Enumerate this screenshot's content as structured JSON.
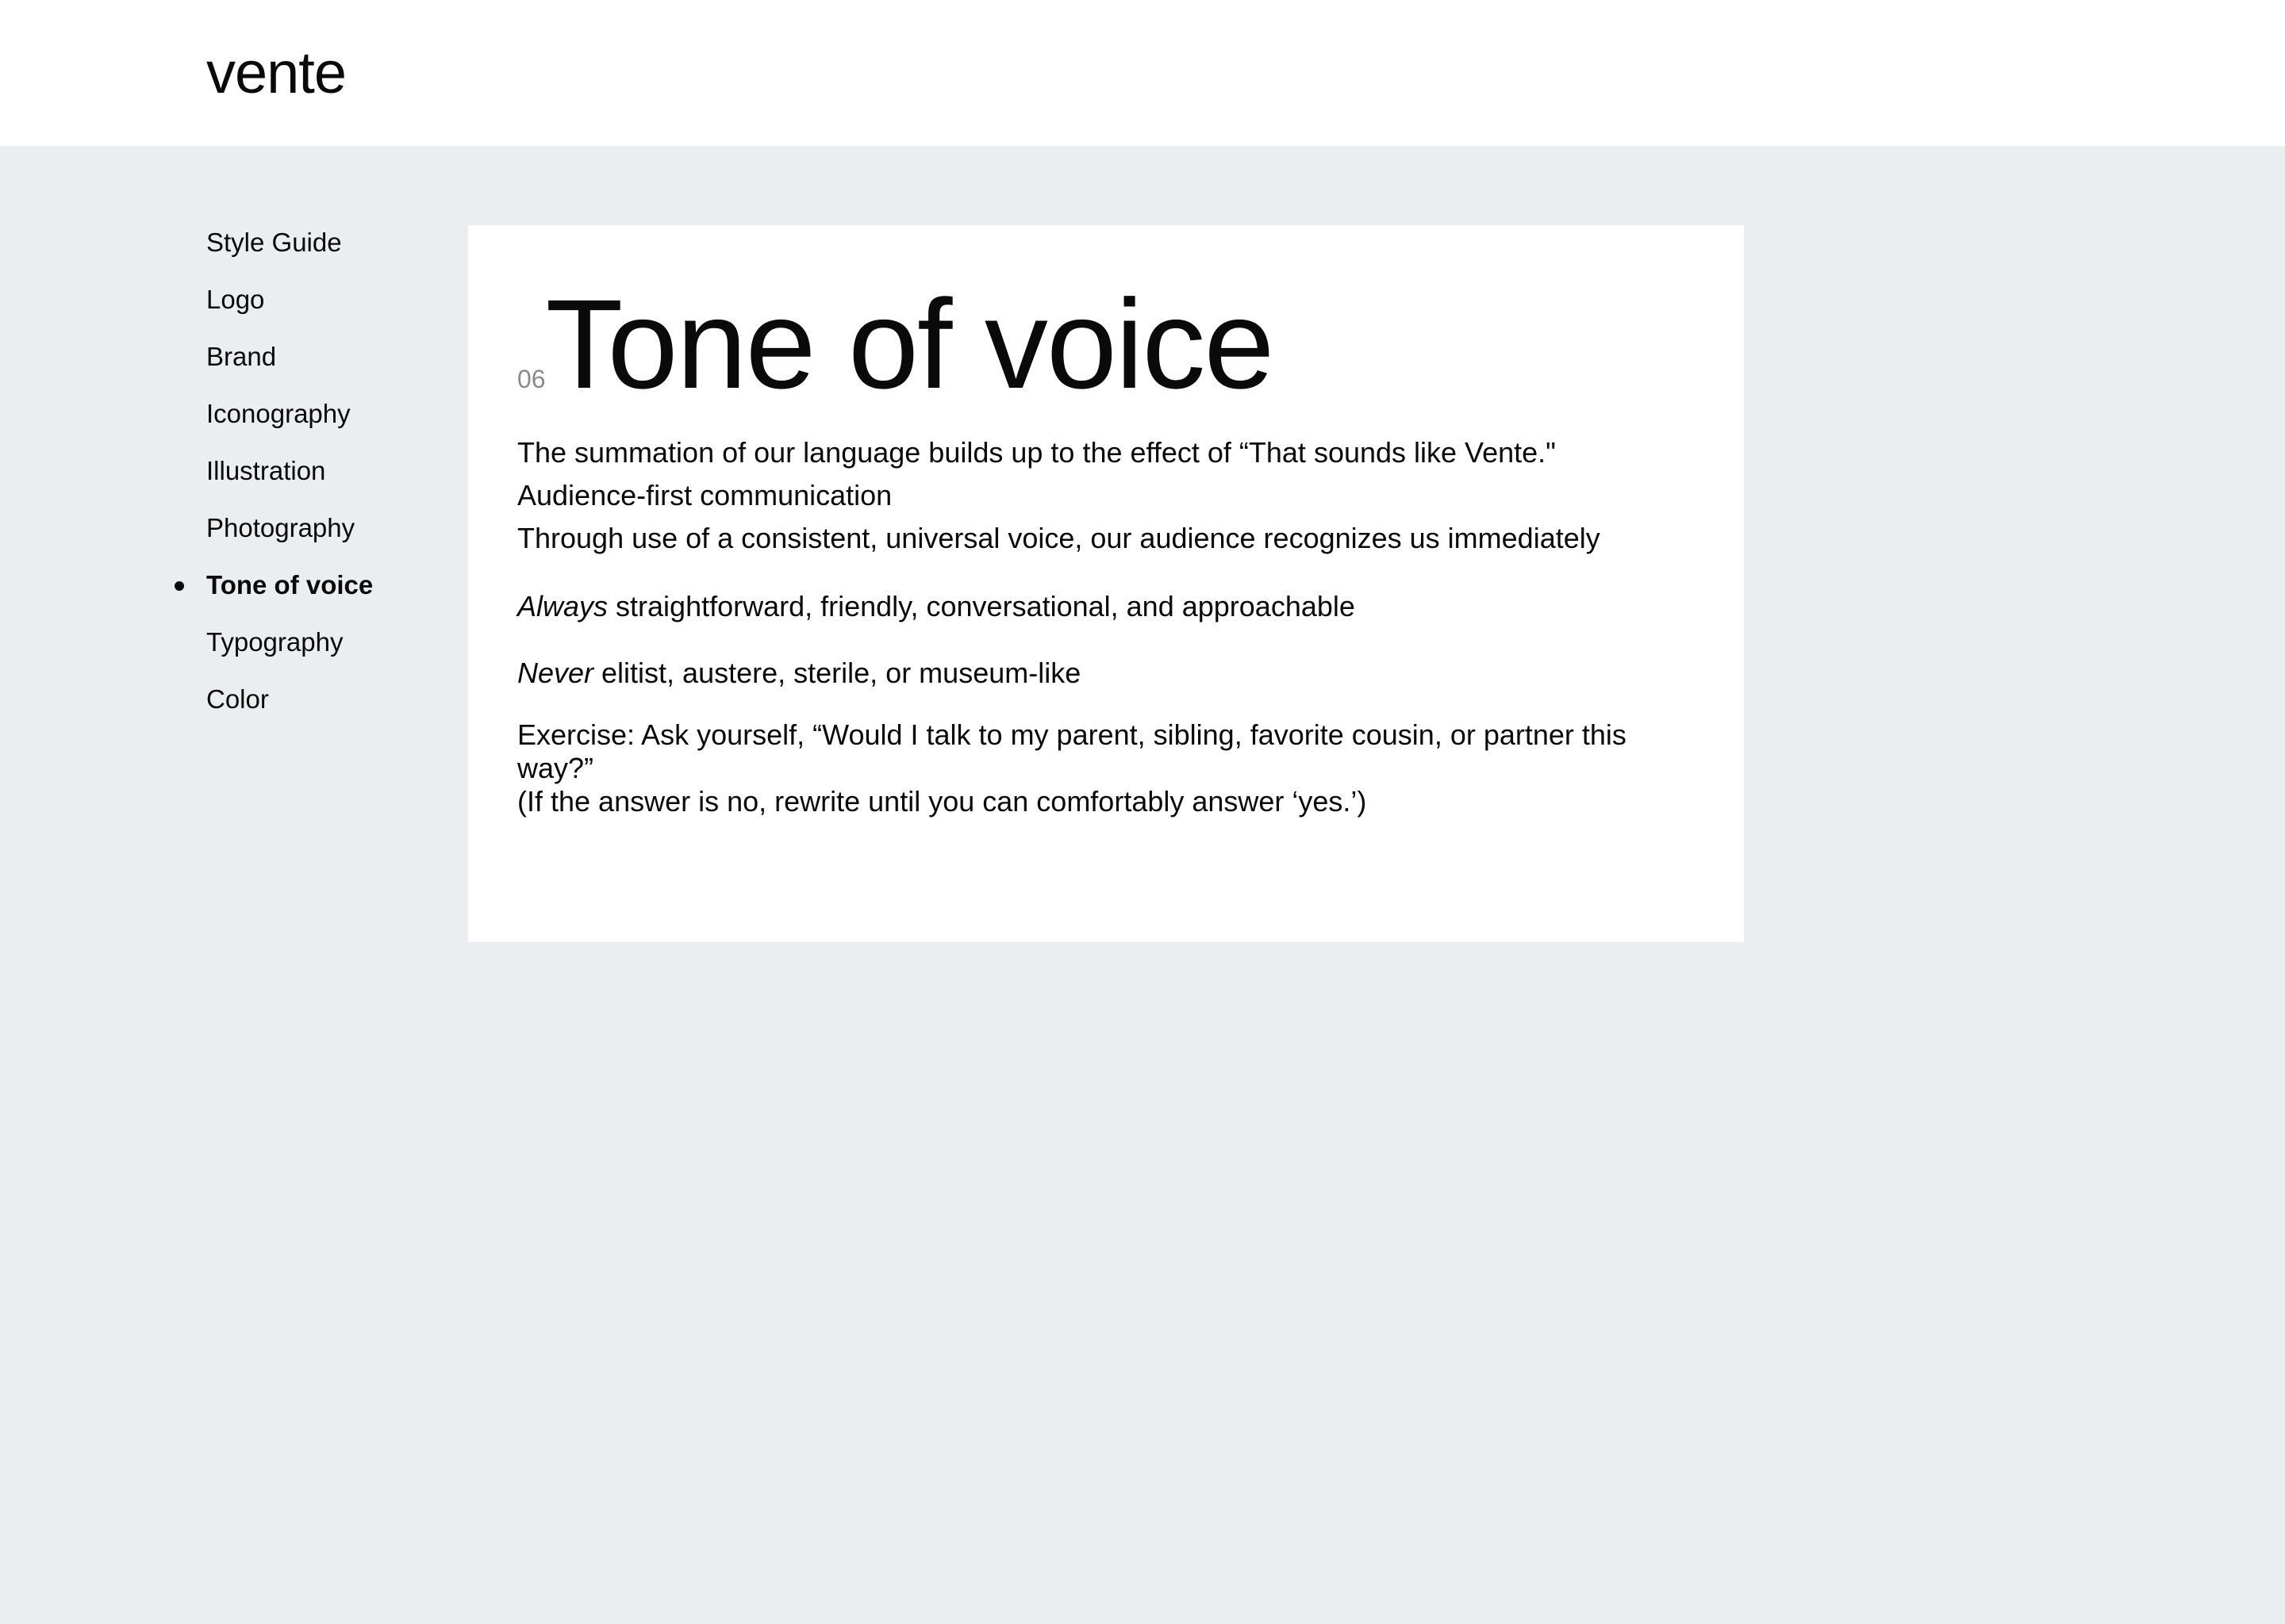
{
  "header": {
    "logo": "vente"
  },
  "sidebar": {
    "items": [
      {
        "label": "Style Guide",
        "active": false
      },
      {
        "label": "Logo",
        "active": false
      },
      {
        "label": "Brand",
        "active": false
      },
      {
        "label": "Iconography",
        "active": false
      },
      {
        "label": "Illustration",
        "active": false
      },
      {
        "label": "Photography",
        "active": false
      },
      {
        "label": "Tone of voice",
        "active": true
      },
      {
        "label": "Typography",
        "active": false
      },
      {
        "label": "Color",
        "active": false
      }
    ]
  },
  "main": {
    "section_number": "06",
    "title": "Tone of voice",
    "intro_lines": [
      "The summation of our language builds up to the effect of “That sounds like Vente.\"",
      "Audience-first communication",
      "Through use of a consistent, universal voice, our audience recognizes us immediately"
    ],
    "always": {
      "emphasis": "Always",
      "text": " straightforward, friendly, conversational, and approachable"
    },
    "never": {
      "emphasis": "Never",
      "text": " elitist, austere, sterile, or museum-like"
    },
    "exercise_lines": [
      "Exercise: Ask yourself, “Would I talk to my parent, sibling, favorite cousin, or partner this way?”",
      "(If the answer is no, rewrite until you can comfortably answer ‘yes.’)"
    ]
  },
  "colors": {
    "background": "#ebeef0",
    "surface": "#ffffff",
    "text": "#0a0a0a",
    "muted": "#8a8a8a"
  }
}
